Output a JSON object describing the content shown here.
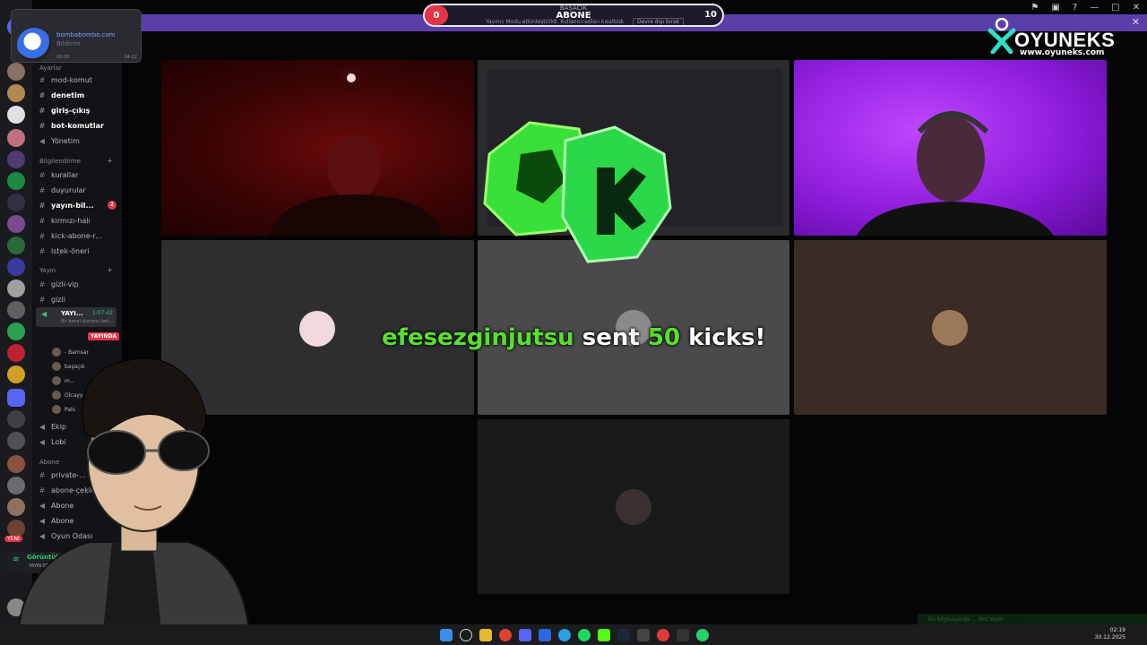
{
  "goal": {
    "start_value": "0",
    "top_text": "BAŞACIK",
    "title": "ABONE",
    "end_value": "10",
    "subtitle": "Yayıncı Modu etkinleştirildi. Kullanıcı adları kısaltıldı.",
    "dismiss_label": "Devre dışı bırak"
  },
  "logo": {
    "name": "OYUNEKS",
    "url": "www.oyuneks.com"
  },
  "popup": {
    "line1": "bombabombo.com",
    "line2": "Bildirim",
    "time_left": "00:00",
    "time_right": "04:22"
  },
  "rail": {
    "badge": "YENİ"
  },
  "channels": {
    "cat_top": "Ayarlar",
    "cat_info": "Bilgilendirme",
    "cat_stream": "Yayın",
    "cat_sub": "Abone",
    "items": [
      {
        "label": "mod-komut"
      },
      {
        "label": "denetim"
      },
      {
        "label": "giriş-çıkış"
      },
      {
        "label": "bot-komutlar"
      },
      {
        "label": "Yönetim"
      },
      {
        "label": "kurallar"
      },
      {
        "label": "duyurular"
      },
      {
        "label": "yayın-bil..."
      },
      {
        "label": "kırmızı-halı"
      },
      {
        "label": "kick-abone-r..."
      },
      {
        "label": "istek-öneri"
      },
      {
        "label": "gizli-vip"
      },
      {
        "label": "gizli"
      },
      {
        "label": "Ekip"
      },
      {
        "label": "Lobi"
      },
      {
        "label": "private-..."
      },
      {
        "label": "abone-çekilı..."
      },
      {
        "label": "Abone"
      },
      {
        "label": "Abone"
      },
      {
        "label": "Oyun Odası"
      }
    ],
    "badge_yayin": "2",
    "active": {
      "name": "YAYI...",
      "time": "1:07:42",
      "sub": "Bir kanal durumu beli..."
    },
    "live_label": "YAYINDA",
    "voice_users": [
      "- Bamsar",
      "başaçık",
      "m...",
      "Olcayy",
      "Pals"
    ]
  },
  "connection": {
    "title": "Görüntülü Bağl...",
    "sub": "YAYIN ODA..."
  },
  "alert": {
    "username": "efesezginjutsu",
    "sent": "sent",
    "amount": "50",
    "unit": "kicks!"
  },
  "notification": {
    "text": "Bu bilgisayarda ... Not Yayın"
  },
  "clock": {
    "time": "02:19",
    "date": "30.12.2025"
  }
}
